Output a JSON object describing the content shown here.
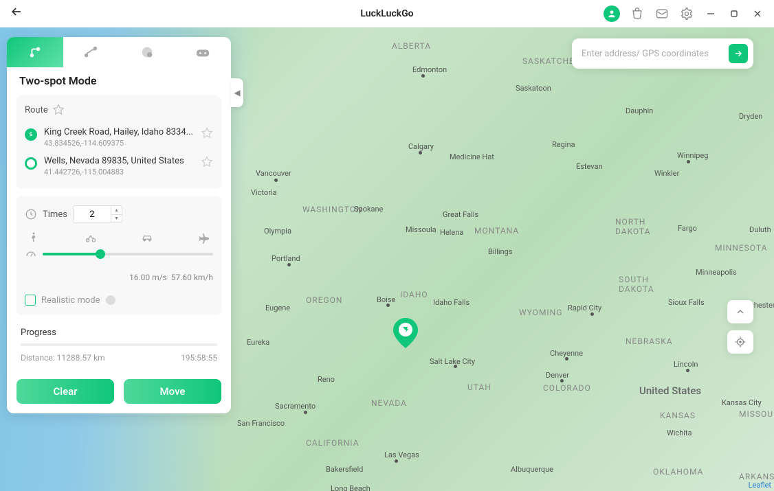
{
  "titlebar": {
    "app_name": "LuckLuckGo"
  },
  "panel": {
    "title": "Two-spot Mode",
    "route_label": "Route",
    "route_items": [
      {
        "address": "King Creek Road, Hailey, Idaho 8334...",
        "coords": "43.834526,-114.609375"
      },
      {
        "address": "Wells, Nevada 89835, United States",
        "coords": "41.442726,-115.004883"
      }
    ],
    "times_label": "Times",
    "times_value": "2",
    "speed_ms": "16.00 m/s",
    "speed_kmh": "57.60 km/h",
    "realistic_label": "Realistic mode",
    "progress_label": "Progress",
    "distance_label": "Distance: 11288.57 km",
    "eta": "195:58:55",
    "clear_label": "Clear",
    "move_label": "Move"
  },
  "search": {
    "placeholder": "Enter address/ GPS coordinates"
  },
  "map": {
    "credit": "Leaflet",
    "country": "United States",
    "states": [
      "ALBERTA",
      "SASKATCHEWAN",
      "WASHINGTON",
      "MONTANA",
      "NORTH DAKOTA",
      "SOUTH DAKOTA",
      "MINNESOTA",
      "OREGON",
      "IDAHO",
      "WYOMING",
      "NEBRASKA",
      "NEVADA",
      "UTAH",
      "COLORADO",
      "KANSAS",
      "CALIFORNIA",
      "OKLAHOMA",
      "MISSOURI",
      "ARKANSAS"
    ],
    "cities": [
      "Edmonton",
      "Saskatoon",
      "Regina",
      "Winnipeg",
      "Dauphin",
      "Dryden",
      "Calgary",
      "Medicine Hat",
      "Estevan",
      "Winkler",
      "Vancouver",
      "Victoria",
      "Spokane",
      "Great Falls",
      "Helena",
      "Missoula",
      "Olympia",
      "Billings",
      "Portland",
      "Fargo",
      "Duluth",
      "Eugene",
      "Rapid City",
      "Boise",
      "Idaho Falls",
      "Minneapolis",
      "Rochester",
      "Sioux Falls",
      "Eureka",
      "Salt Lake City",
      "Cheyenne",
      "Lincoln",
      "Reno",
      "Denver",
      "Kansas City",
      "Sacramento",
      "San Francisco",
      "Las Vegas",
      "Albuquerque",
      "Bakersfield",
      "Wichita",
      "Long Beach"
    ]
  }
}
